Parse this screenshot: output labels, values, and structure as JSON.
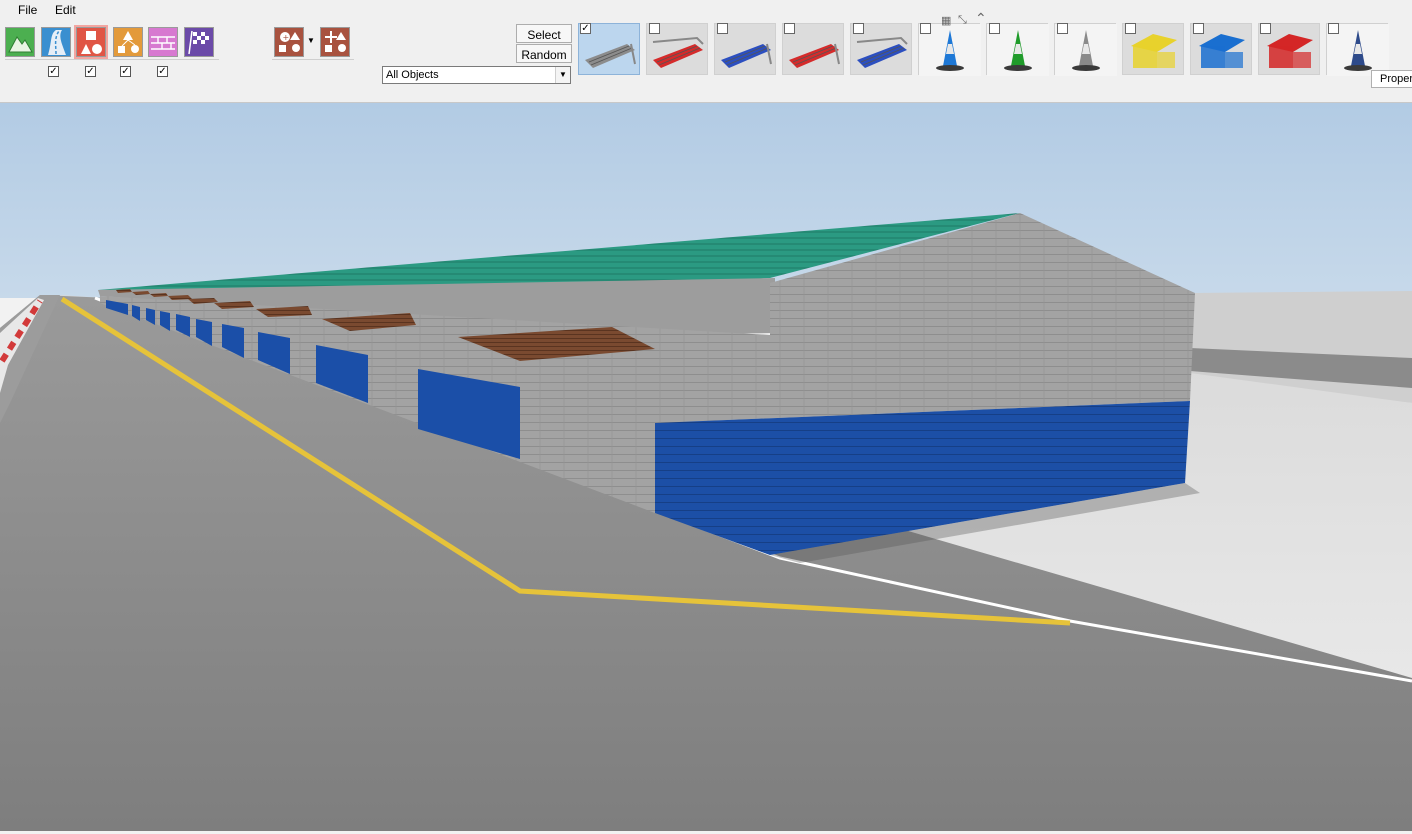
{
  "menu": {
    "file": "File",
    "edit": "Edit"
  },
  "toolbar": {
    "tools": [
      {
        "name": "terrain-tool",
        "icon": "mountain-icon",
        "color": "#4caf50"
      },
      {
        "name": "road-tool",
        "icon": "road-icon",
        "color": "#3a8fd0"
      },
      {
        "name": "shapes-tool",
        "icon": "shapes-icon",
        "color": "#e05545"
      },
      {
        "name": "nodes-tool",
        "icon": "nodes-icon",
        "color": "#e39a3b"
      },
      {
        "name": "wall-tool",
        "icon": "brick-wall-icon",
        "color": "#d779d0"
      },
      {
        "name": "finish-tool",
        "icon": "checkered-flag-icon",
        "color": "#6b4aa8"
      }
    ],
    "tool_checks": [
      true,
      true,
      true,
      true
    ],
    "object_tools": [
      {
        "name": "add-object-tool",
        "icon": "add-object-icon",
        "has_dropdown": true
      },
      {
        "name": "move-object-tool",
        "icon": "move-object-icon",
        "has_dropdown": false
      }
    ],
    "select_label": "Select",
    "random_label": "Random",
    "filter": {
      "selected": "All Objects"
    }
  },
  "objects": [
    {
      "name": "grandstand-grey",
      "checked": true,
      "selected": true,
      "color": "#8c8c8c"
    },
    {
      "name": "grandstand-red-covered",
      "checked": false,
      "selected": false,
      "color": "#d52b2b"
    },
    {
      "name": "grandstand-blue",
      "checked": false,
      "selected": false,
      "color": "#2c4fc0"
    },
    {
      "name": "grandstand-red",
      "checked": false,
      "selected": false,
      "color": "#d52b2b"
    },
    {
      "name": "grandstand-blue-covered",
      "checked": false,
      "selected": false,
      "color": "#2c4fc0"
    },
    {
      "name": "portable-toilet-blue",
      "checked": false,
      "selected": false,
      "color": "#1e78d6"
    },
    {
      "name": "portable-toilet-green",
      "checked": false,
      "selected": false,
      "color": "#1f9b2a"
    },
    {
      "name": "portable-toilet-grey",
      "checked": false,
      "selected": false,
      "color": "#8a8a8a"
    },
    {
      "name": "tent-yellow",
      "checked": false,
      "selected": false,
      "color": "#e8d22c"
    },
    {
      "name": "tent-blue",
      "checked": false,
      "selected": false,
      "color": "#1a6fd0"
    },
    {
      "name": "tent-red",
      "checked": false,
      "selected": false,
      "color": "#d42626"
    },
    {
      "name": "traffic-cone",
      "checked": false,
      "selected": false,
      "color": "#2d4a8a"
    }
  ],
  "properties_tab": "Proper",
  "scene": {
    "description_colors": {
      "sky": "#b6cfe6",
      "roof": "#2a9a7e",
      "wall": "#9c9c9c",
      "door": "#1b4fa8",
      "road": "#8a8a8a",
      "line": "#e6c33a"
    }
  }
}
